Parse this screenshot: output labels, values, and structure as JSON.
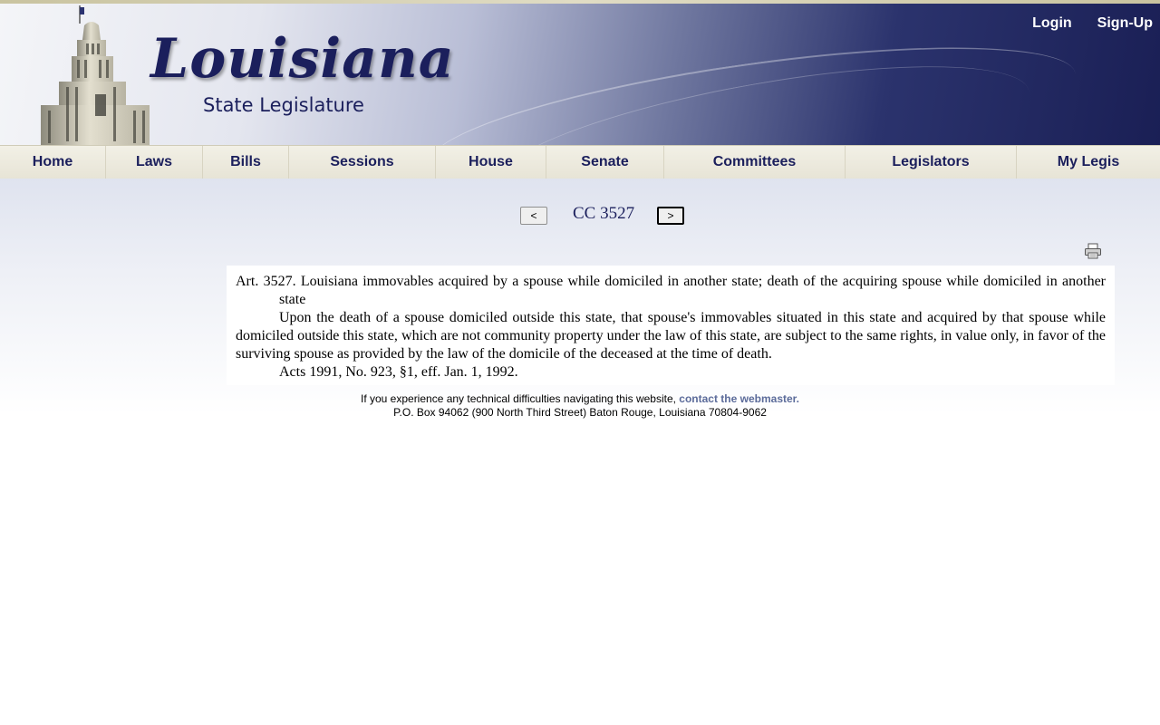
{
  "header": {
    "logo_title": "Louisiana",
    "logo_subtitle": "State Legislature",
    "login_label": "Login",
    "signup_label": "Sign-Up"
  },
  "nav": {
    "items": [
      {
        "label": "Home"
      },
      {
        "label": "Laws"
      },
      {
        "label": "Bills"
      },
      {
        "label": "Sessions"
      },
      {
        "label": "House"
      },
      {
        "label": "Senate"
      },
      {
        "label": "Committees"
      },
      {
        "label": "Legislators"
      },
      {
        "label": "My Legis"
      }
    ]
  },
  "pager": {
    "prev_label": "<",
    "title": "CC 3527",
    "next_label": ">"
  },
  "document": {
    "heading": "Art. 3527.  Louisiana immovables acquired by a spouse while domiciled in another state; death of the acquiring spouse while domiciled in another state",
    "body": "Upon the death of a spouse domiciled outside this state, that spouse's immovables situated in this state and acquired by that spouse while domiciled outside this state, which are not community property under the law of this state, are subject to the same rights, in value only, in favor of the surviving spouse as provided by the law of the domicile of the deceased at the time of death.",
    "history": "Acts 1991, No. 923, §1, eff. Jan. 1, 1992."
  },
  "footer": {
    "line1_text": "If you experience any technical difficulties navigating this website, ",
    "line1_link": "contact the webmaster.",
    "line2": "P.O. Box 94062 (900 North Third Street) Baton Rouge, Louisiana 70804-9062"
  },
  "colors": {
    "brand_navy": "#1b1f5c",
    "nav_bg": "#ece9dc",
    "link": "#5b6b9a"
  }
}
